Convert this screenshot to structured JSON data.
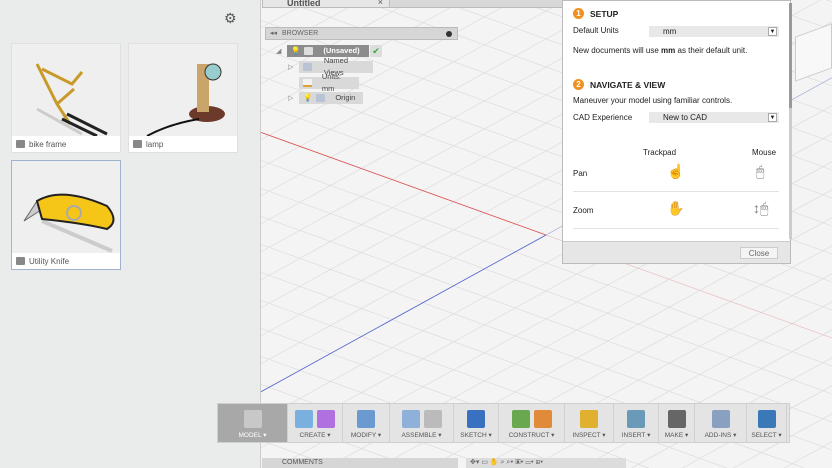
{
  "left_panel": {
    "gear_icon": "gear-icon",
    "designs": [
      {
        "name": "bike frame"
      },
      {
        "name": "lamp"
      },
      {
        "name": "Utility Knife",
        "selected": true
      }
    ]
  },
  "document_tab": {
    "title": "Untitled",
    "close": "×"
  },
  "browser": {
    "title": "BROWSER",
    "root": "(Unsaved)",
    "items": [
      "Named Views",
      "Units: mm",
      "Origin"
    ]
  },
  "dialog": {
    "setup": {
      "num": "1",
      "title": "SETUP",
      "units_label": "Default Units",
      "units_value": "mm",
      "note_pre": "New documents will use ",
      "note_bold": "mm",
      "note_post": " as their default unit."
    },
    "navigate": {
      "num": "2",
      "title": "NAVIGATE & VIEW",
      "desc": "Maneuver your model using familiar controls.",
      "cad_label": "CAD Experience",
      "cad_value": "New to CAD",
      "col_trackpad": "Trackpad",
      "col_mouse": "Mouse",
      "rows": [
        "Pan",
        "Zoom"
      ]
    },
    "close_label": "Close"
  },
  "toolbar": {
    "groups": [
      "MODEL",
      "CREATE",
      "MODIFY",
      "ASSEMBLE",
      "SKETCH",
      "CONSTRUCT",
      "INSPECT",
      "INSERT",
      "MAKE",
      "ADD-INS",
      "SELECT"
    ]
  },
  "bottom": {
    "comments": "COMMENTS"
  },
  "colors": {
    "accent": "#f0901e",
    "x_axis": "#e05050",
    "y_axis": "#5060d0",
    "select": "#3a78b8"
  }
}
